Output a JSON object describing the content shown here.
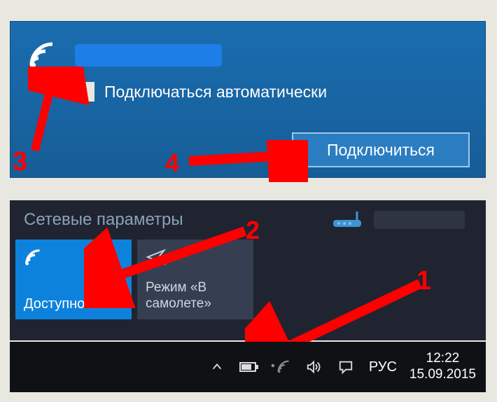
{
  "network_popup": {
    "auto_connect_label": "Подключаться автоматически",
    "connect_button": "Подключиться"
  },
  "settings": {
    "title": "Сетевые параметры",
    "wifi_tile_label": "Доступно",
    "airplane_tile_label": "Режим «В самолете»"
  },
  "taskbar": {
    "lang": "РУС",
    "time": "12:22",
    "date": "15.09.2015"
  },
  "annotations": {
    "step1": "1",
    "step2": "2",
    "step3": "3",
    "step4": "4"
  }
}
